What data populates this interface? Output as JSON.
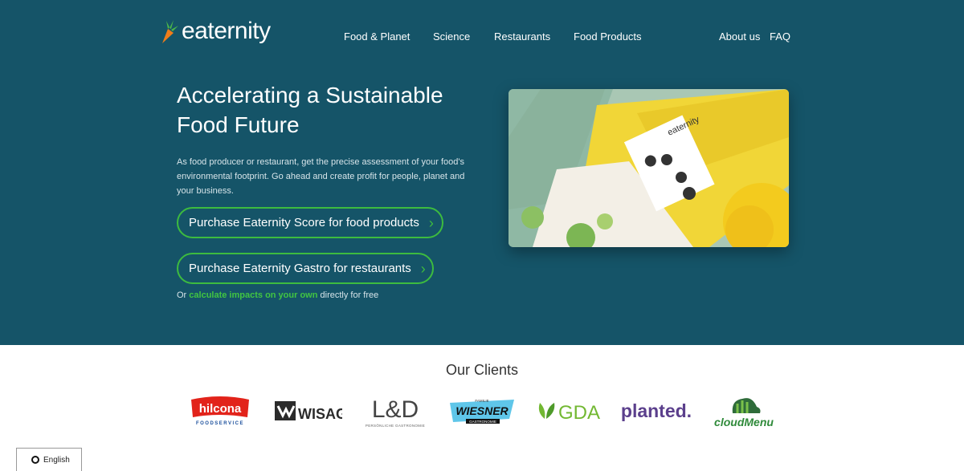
{
  "header": {
    "logo_text": "eaternity",
    "nav_items": [
      "Food & Planet",
      "Science",
      "Restaurants",
      "Food Products"
    ],
    "secondary_nav": [
      "About us",
      "FAQ"
    ]
  },
  "hero": {
    "title": "Accelerating a Sustainable Food Future",
    "description": "As food producer or restaurant, get the precise assessment of your food's environmental footprint. Go ahead and create profit for people, planet and your business.",
    "cta_primary": "Purchase Eaternity Score for food products",
    "cta_secondary": "Purchase Eaternity Gastro for restaurants",
    "free_prefix": "Or",
    "free_link": "calculate impacts on your own",
    "free_suffix": "directly for free",
    "image_label": "eaternity"
  },
  "clients": {
    "title": "Our Clients",
    "logos": [
      {
        "name": "hilcona",
        "text": "hilcona",
        "subtext": "FOODSERVICE"
      },
      {
        "name": "wisag",
        "text": "WISAG"
      },
      {
        "name": "l-and-d",
        "text": "L&D",
        "subtext": "PERSÖNLICHE GASTRONOMIE"
      },
      {
        "name": "wiesner",
        "text": "WIESNER",
        "subtext": "GASTRONOMIE",
        "small": "FAMILIE"
      },
      {
        "name": "gda",
        "text": "GDA"
      },
      {
        "name": "planted",
        "text": "planted."
      },
      {
        "name": "cloudmenu",
        "text": "cloudMenu"
      }
    ]
  },
  "language": {
    "label": "English"
  },
  "colors": {
    "hero_bg": "#155468",
    "accent_green": "#3dbb3f",
    "link_green": "#41c542"
  }
}
